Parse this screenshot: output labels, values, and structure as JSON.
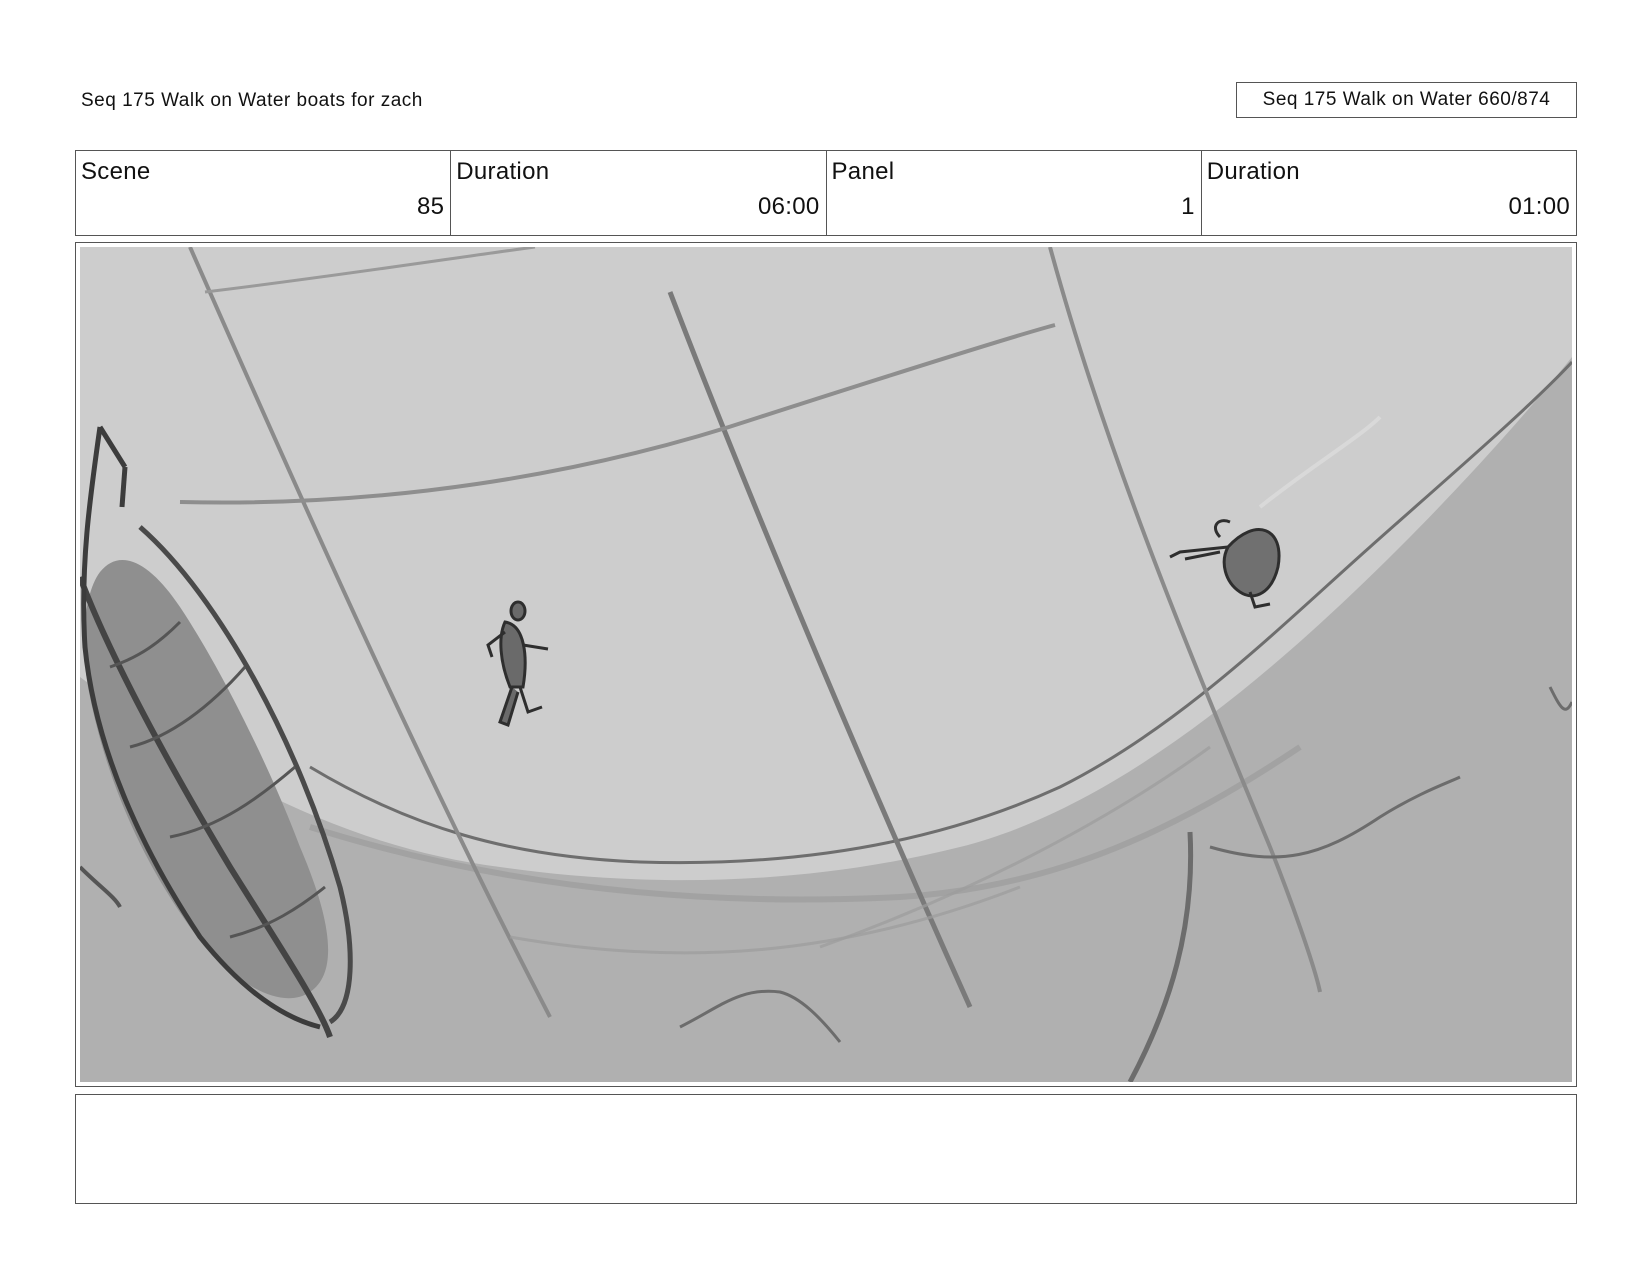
{
  "page": {
    "title": "Seq 175 Walk on Water  boats for zach",
    "page_label": "Seq 175 Walk on Water 660/874"
  },
  "info": {
    "scene_label": "Scene",
    "scene_value": "85",
    "scene_duration_label": "Duration",
    "scene_duration_value": "06:00",
    "panel_label": "Panel",
    "panel_value": "1",
    "panel_duration_label": "Duration",
    "panel_duration_value": "01:00"
  },
  "notes": {
    "text": ""
  },
  "colors": {
    "sky": "#cdcdcd",
    "water": "#b0b0b0",
    "stroke_dark": "#3c3c3c",
    "stroke_mid": "#7e7e7e",
    "boat_shadow": "#8f8f8f"
  }
}
